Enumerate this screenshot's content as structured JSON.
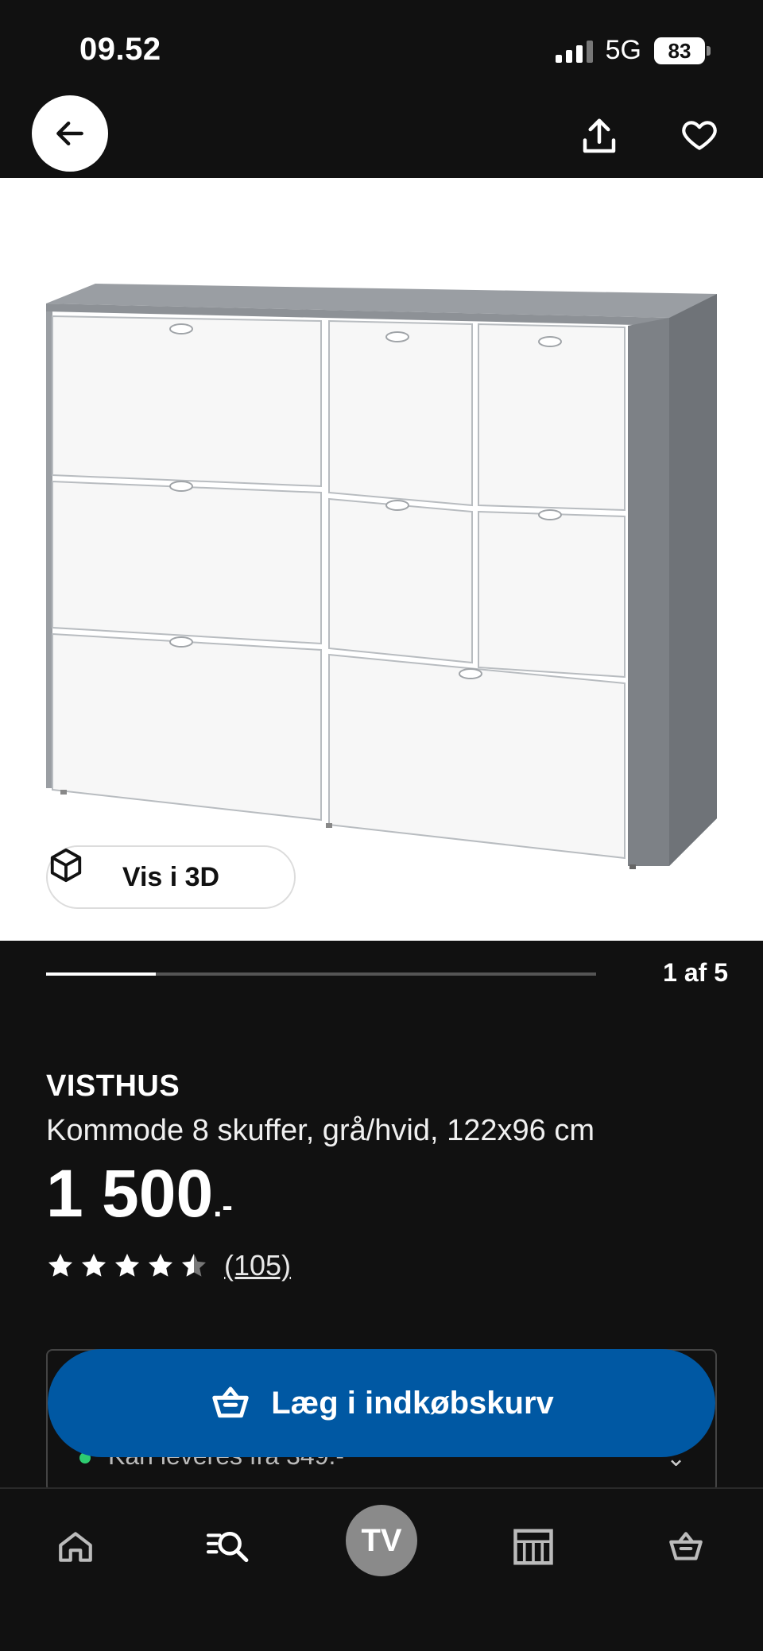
{
  "status_bar": {
    "time": "09.52",
    "network": "5G",
    "battery": "83"
  },
  "product": {
    "brand": "VISTHUS",
    "description": "Kommode 8 skuffer, grå/hvid, 122x96 cm",
    "price": "1 500",
    "price_suffix": ".-",
    "rating_value": 4.5,
    "rating_max": 5,
    "review_count": "(105)"
  },
  "gallery": {
    "counter": "1 af 5",
    "progress_fraction": 0.2,
    "view_3d_label": "Vis i 3D"
  },
  "delivery": {
    "text": "Kan leveres fra 349.-"
  },
  "cart": {
    "add_label": "Læg i indkøbskurv"
  },
  "bottom_nav": {
    "tv_label": "TV",
    "items": [
      "home-icon",
      "search-icon",
      "tv",
      "store-icon",
      "basket-icon"
    ]
  },
  "colors": {
    "background": "#111111",
    "accent_blue": "#0058a3",
    "delivery_dot": "#2ecc71"
  }
}
